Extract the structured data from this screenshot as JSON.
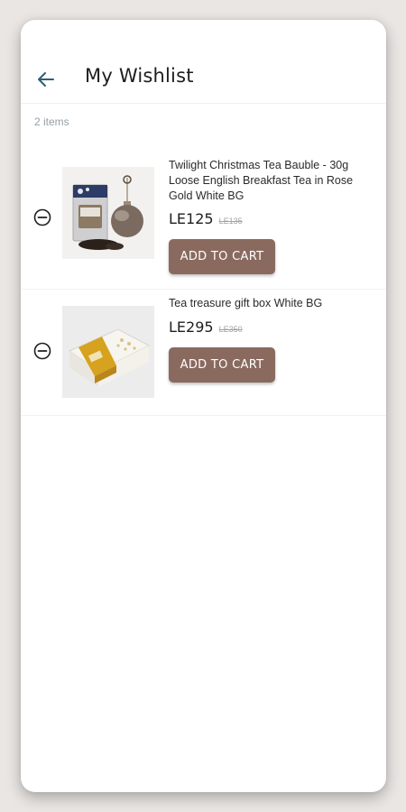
{
  "header": {
    "back_icon": "arrow-left-icon",
    "title": "My Wishlist"
  },
  "wishlist": {
    "count_label": "2 items",
    "items": [
      {
        "name": "Twilight Christmas Tea Bauble - 30g Loose English Breakfast Tea in Rose Gold White BG",
        "price": "LE125",
        "old_price": "LE135",
        "button_label": "ADD TO CART",
        "remove_icon": "minus-circle-icon",
        "image_icon": "tea-bauble-product-image"
      },
      {
        "name": "Tea treasure gift box White BG",
        "price": "LE295",
        "old_price": "LE350",
        "button_label": "ADD TO CART",
        "remove_icon": "minus-circle-icon",
        "image_icon": "gift-box-product-image"
      }
    ]
  },
  "colors": {
    "button": "#8a6a5f",
    "back_arrow": "#2b5f73",
    "muted_text": "#93a0a8",
    "background": "#e9e6e3"
  }
}
